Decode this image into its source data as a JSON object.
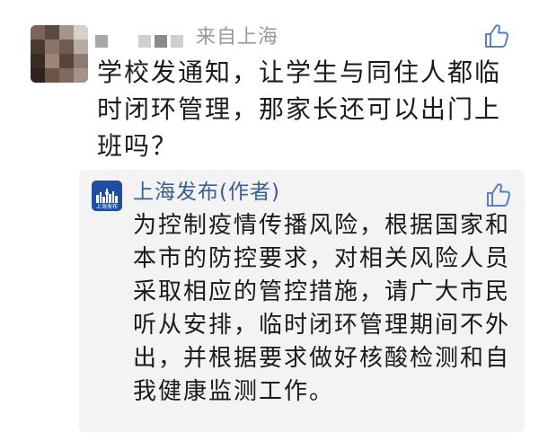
{
  "comment": {
    "username_redacted": true,
    "location": "来自上海",
    "text": "学校发通知，让学生与同住人都临时闭环管理，那家长还可以出门上班吗？",
    "like_icon": "thumbs-up-icon"
  },
  "reply": {
    "avatar_label": "上海发布",
    "author": "上海发布(作者)",
    "text": "为控制疫情传播风险，根据国家和本市的防控要求，对相关风险人员采取相应的管控措施，请广大市民听从安排，临时闭环管理期间不外出，并根据要求做好核酸检测和自我健康监测工作。",
    "like_icon": "thumbs-up-icon"
  },
  "colors": {
    "author_link": "#3a5f95",
    "meta_gray": "#9a9a9a",
    "reply_bg": "#f3f3f3",
    "avatar_blue": "#1f4fa3",
    "icon_blue": "#5a7fc4"
  }
}
